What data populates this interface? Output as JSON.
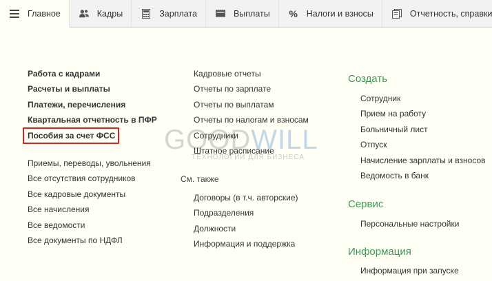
{
  "tabs": [
    {
      "label": "Главное",
      "icon": "menu-icon"
    },
    {
      "label": "Кадры",
      "icon": "users-icon"
    },
    {
      "label": "Зарплата",
      "icon": "calculator-icon"
    },
    {
      "label": "Выплаты",
      "icon": "wallet-icon"
    },
    {
      "label": "Налоги и взносы",
      "icon": "percent-icon"
    },
    {
      "label": "Отчетность, справки",
      "icon": "documents-icon"
    }
  ],
  "column1": {
    "bold_items": [
      "Работа с кадрами",
      "Расчеты и выплаты",
      "Платежи, перечисления",
      "Квартальная отчетность в ПФР",
      "Пособия за счет ФСС"
    ],
    "items": [
      "Приемы, переводы, увольнения",
      "Все отсутствия сотрудников",
      "Все кадровые документы",
      "Все начисления",
      "Все ведомости",
      "Все документы по НДФЛ"
    ]
  },
  "column2": {
    "items": [
      "Кадровые отчеты",
      "Отчеты по зарплате",
      "Отчеты по выплатам",
      "Отчеты по налогам и взносам",
      "Сотрудники",
      "Штатное расписание"
    ],
    "see_also_label": "См. также",
    "see_also": [
      "Договоры (в т.ч. авторские)",
      "Подразделения",
      "Должности",
      "Информация и поддержка"
    ]
  },
  "column3": {
    "create": {
      "title": "Создать",
      "items": [
        "Сотрудник",
        "Прием на работу",
        "Больничный лист",
        "Отпуск",
        "Начисление зарплаты и взносов",
        "Ведомость в банк"
      ]
    },
    "service": {
      "title": "Сервис",
      "items": [
        "Персональные настройки"
      ]
    },
    "info": {
      "title": "Информация",
      "items": [
        "Информация при запуске"
      ]
    }
  },
  "watermark": {
    "part1": "GOOD",
    "part2": "WILL",
    "subtitle": "ТЕХНОЛОГИИ ДЛЯ БИЗНЕСА"
  },
  "colors": {
    "heading": "#3c9a52",
    "highlight": "#d9231e"
  }
}
